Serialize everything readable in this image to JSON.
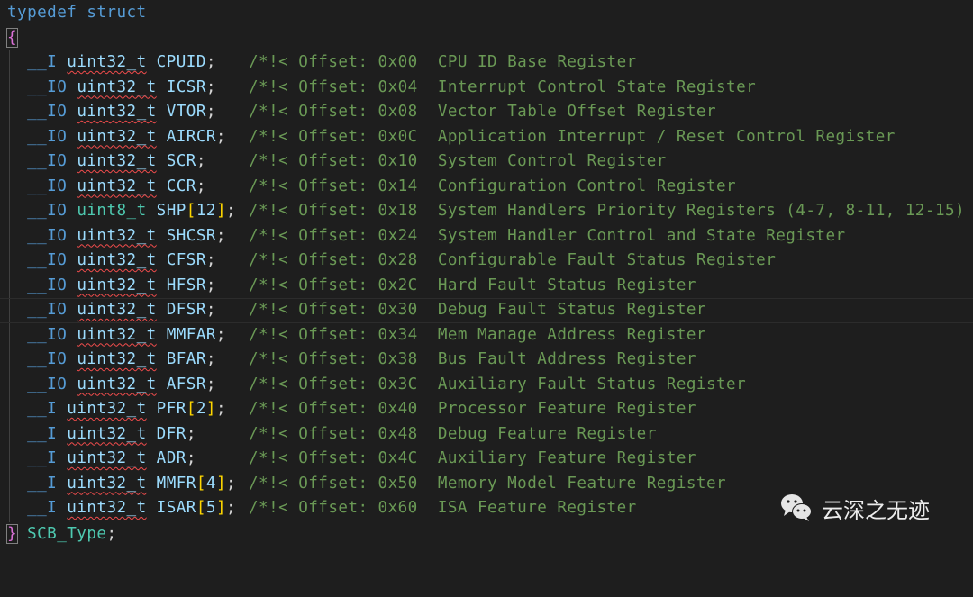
{
  "editor": {
    "header": {
      "keyword1": "typedef",
      "keyword2": "struct"
    },
    "open_brace": "{",
    "close_brace": "}",
    "type_name": "SCB_Type",
    "terminator": ";",
    "current_line_index": 10,
    "members": [
      {
        "qualifier": "__I",
        "type": "uint32_t",
        "name": "CPUID",
        "array": "",
        "comment_prefix": "/*!<",
        "offset": "Offset: 0x00",
        "description": "CPU ID Base Register"
      },
      {
        "qualifier": "__IO",
        "type": "uint32_t",
        "name": "ICSR",
        "array": "",
        "comment_prefix": "/*!<",
        "offset": "Offset: 0x04",
        "description": "Interrupt Control State Register"
      },
      {
        "qualifier": "__IO",
        "type": "uint32_t",
        "name": "VTOR",
        "array": "",
        "comment_prefix": "/*!<",
        "offset": "Offset: 0x08",
        "description": "Vector Table Offset Register"
      },
      {
        "qualifier": "__IO",
        "type": "uint32_t",
        "name": "AIRCR",
        "array": "",
        "comment_prefix": "/*!<",
        "offset": "Offset: 0x0C",
        "description": "Application Interrupt / Reset Control Register"
      },
      {
        "qualifier": "__IO",
        "type": "uint32_t",
        "name": "SCR",
        "array": "",
        "comment_prefix": "/*!<",
        "offset": "Offset: 0x10",
        "description": "System Control Register"
      },
      {
        "qualifier": "__IO",
        "type": "uint32_t",
        "name": "CCR",
        "array": "",
        "comment_prefix": "/*!<",
        "offset": "Offset: 0x14",
        "description": "Configuration Control Register"
      },
      {
        "qualifier": "__IO",
        "type": "uint8_t",
        "name": "SHP",
        "array": "12",
        "comment_prefix": "/*!<",
        "offset": "Offset: 0x18",
        "description": "System Handlers Priority Registers (4-7, 8-11, 12-15)"
      },
      {
        "qualifier": "__IO",
        "type": "uint32_t",
        "name": "SHCSR",
        "array": "",
        "comment_prefix": "/*!<",
        "offset": "Offset: 0x24",
        "description": "System Handler Control and State Register"
      },
      {
        "qualifier": "__IO",
        "type": "uint32_t",
        "name": "CFSR",
        "array": "",
        "comment_prefix": "/*!<",
        "offset": "Offset: 0x28",
        "description": "Configurable Fault Status Register"
      },
      {
        "qualifier": "__IO",
        "type": "uint32_t",
        "name": "HFSR",
        "array": "",
        "comment_prefix": "/*!<",
        "offset": "Offset: 0x2C",
        "description": "Hard Fault Status Register"
      },
      {
        "qualifier": "__IO",
        "type": "uint32_t",
        "name": "DFSR",
        "array": "",
        "comment_prefix": "/*!<",
        "offset": "Offset: 0x30",
        "description": "Debug Fault Status Register"
      },
      {
        "qualifier": "__IO",
        "type": "uint32_t",
        "name": "MMFAR",
        "array": "",
        "comment_prefix": "/*!<",
        "offset": "Offset: 0x34",
        "description": "Mem Manage Address Register"
      },
      {
        "qualifier": "__IO",
        "type": "uint32_t",
        "name": "BFAR",
        "array": "",
        "comment_prefix": "/*!<",
        "offset": "Offset: 0x38",
        "description": "Bus Fault Address Register"
      },
      {
        "qualifier": "__IO",
        "type": "uint32_t",
        "name": "AFSR",
        "array": "",
        "comment_prefix": "/*!<",
        "offset": "Offset: 0x3C",
        "description": "Auxiliary Fault Status Register"
      },
      {
        "qualifier": "__I",
        "type": "uint32_t",
        "name": "PFR",
        "array": "2",
        "comment_prefix": "/*!<",
        "offset": "Offset: 0x40",
        "description": "Processor Feature Register"
      },
      {
        "qualifier": "__I",
        "type": "uint32_t",
        "name": "DFR",
        "array": "",
        "comment_prefix": "/*!<",
        "offset": "Offset: 0x48",
        "description": "Debug Feature Register"
      },
      {
        "qualifier": "__I",
        "type": "uint32_t",
        "name": "ADR",
        "array": "",
        "comment_prefix": "/*!<",
        "offset": "Offset: 0x4C",
        "description": "Auxiliary Feature Register"
      },
      {
        "qualifier": "__I",
        "type": "uint32_t",
        "name": "MMFR",
        "array": "4",
        "comment_prefix": "/*!<",
        "offset": "Offset: 0x50",
        "description": "Memory Model Feature Register"
      },
      {
        "qualifier": "__I",
        "type": "uint32_t",
        "name": "ISAR",
        "array": "5",
        "comment_prefix": "/*!<",
        "offset": "Offset: 0x60",
        "description": "ISA Feature Register"
      }
    ]
  },
  "watermark": {
    "icon": "wechat-icon",
    "text": "云深之无迹"
  }
}
